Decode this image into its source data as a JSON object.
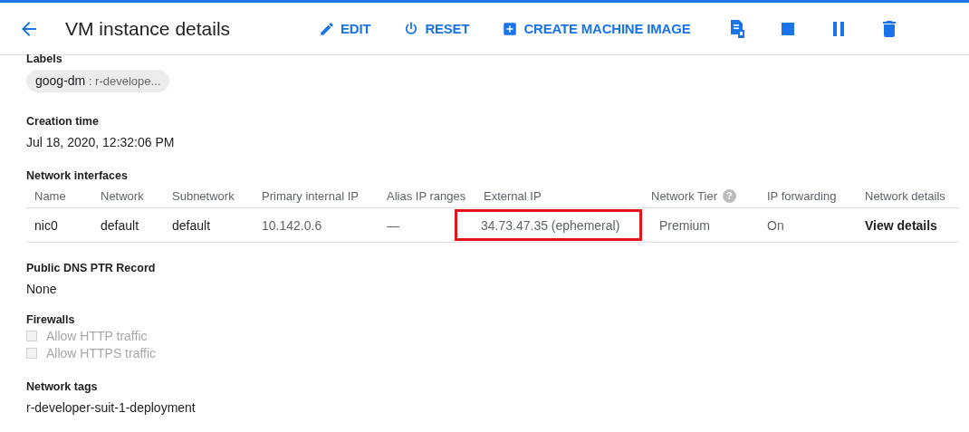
{
  "header": {
    "title": "VM instance details",
    "actions": [
      {
        "kind": "edit",
        "label": "EDIT"
      },
      {
        "kind": "reset",
        "label": "RESET"
      },
      {
        "kind": "create",
        "label": "CREATE MACHINE IMAGE"
      },
      {
        "kind": "ssh"
      },
      {
        "kind": "stop"
      },
      {
        "kind": "pause"
      },
      {
        "kind": "delete"
      }
    ]
  },
  "labels": {
    "heading": "Labels",
    "chips": [
      {
        "key": "goog-dm",
        "value": ": r-develope..."
      }
    ]
  },
  "creation_time": {
    "heading": "Creation time",
    "value": "Jul 18, 2020, 12:32:06 PM"
  },
  "network_interfaces": {
    "heading": "Network interfaces",
    "columns": [
      {
        "label": "Name"
      },
      {
        "label": "Network"
      },
      {
        "label": "Subnetwork"
      },
      {
        "label": "Primary internal IP"
      },
      {
        "label": "Alias IP ranges"
      },
      {
        "label": "External IP"
      },
      {
        "label": "Network Tier",
        "help_icon": "?"
      },
      {
        "label": "IP forwarding"
      },
      {
        "label": "Network details"
      }
    ],
    "rows": [
      {
        "cells": [
          {
            "text": "nic0",
            "highlighted": false
          },
          {
            "text": "default",
            "highlighted": false
          },
          {
            "text": "default",
            "highlighted": false
          },
          {
            "text": "10.142.0.6",
            "highlighted": false
          },
          {
            "text": "—",
            "highlighted": false
          },
          {
            "text": "34.73.47.35 (ephemeral)",
            "highlighted": true
          },
          {
            "text": "Premium",
            "highlighted": false
          },
          {
            "text": "On",
            "highlighted": false
          },
          {
            "text": "View details",
            "highlighted": false,
            "kind": "link"
          }
        ]
      }
    ]
  },
  "dns": {
    "heading": "Public DNS PTR Record",
    "value": "None"
  },
  "firewalls": {
    "heading": "Firewalls",
    "options": [
      {
        "label": "Allow HTTP traffic",
        "checked": false,
        "disabled": true
      },
      {
        "label": "Allow HTTPS traffic",
        "checked": false,
        "disabled": true
      }
    ]
  },
  "network_tags": {
    "heading": "Network tags",
    "value": "r-developer-suit-1-deployment"
  }
}
